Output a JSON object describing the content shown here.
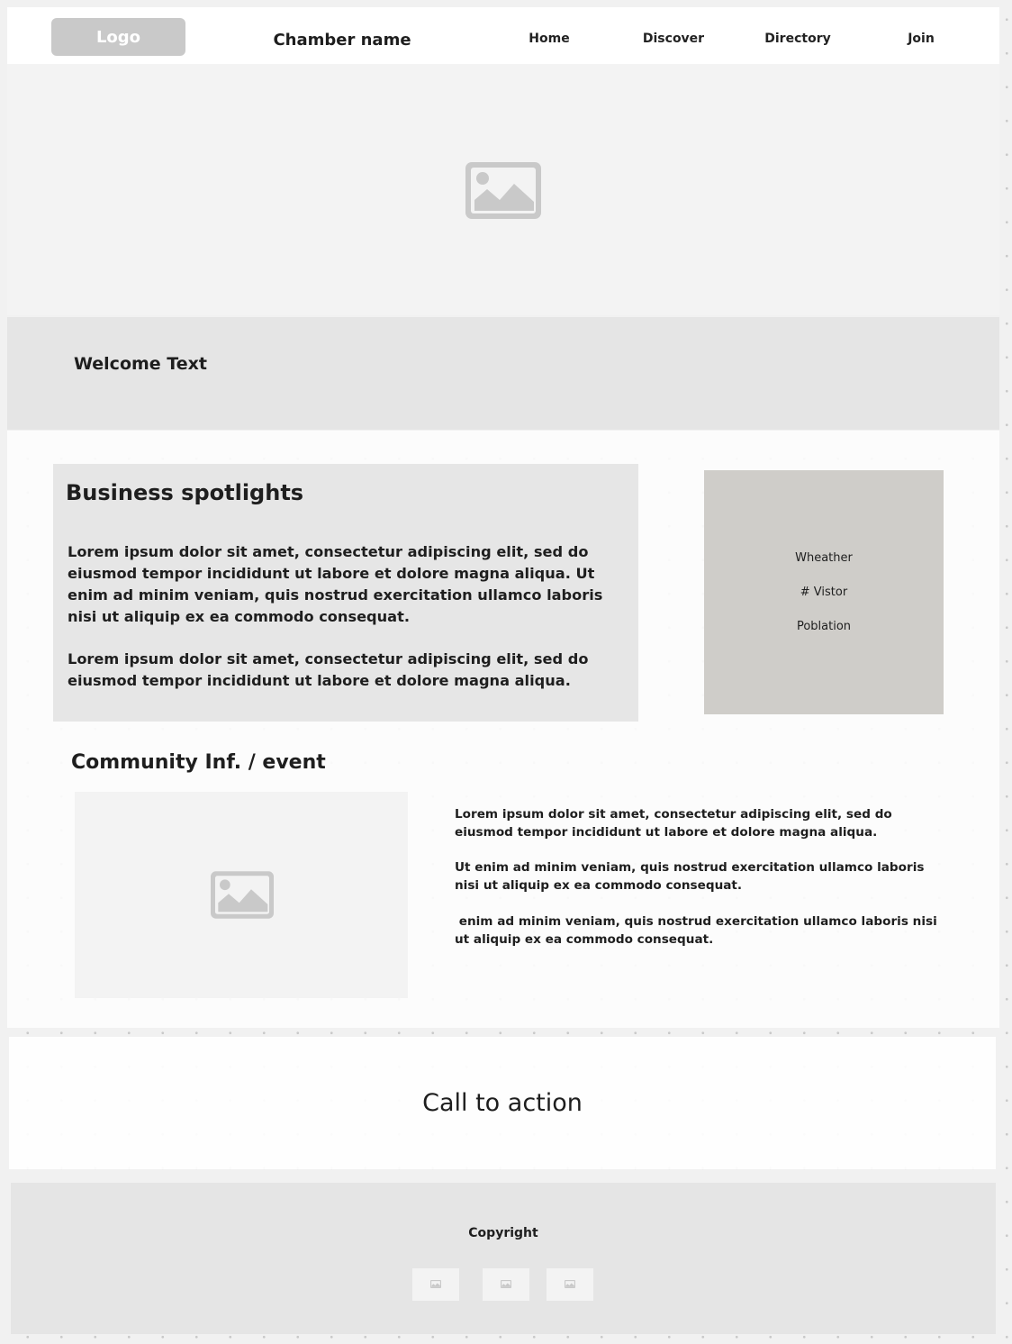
{
  "header": {
    "logo_label": "Logo",
    "chamber_name": "Chamber name",
    "nav": [
      {
        "label": "Home"
      },
      {
        "label": "Discover"
      },
      {
        "label": "Directory"
      },
      {
        "label": "Join"
      }
    ]
  },
  "hero": {
    "image_icon": "image-placeholder-icon"
  },
  "welcome": {
    "text": "Welcome Text"
  },
  "business_spotlights": {
    "title": "Business spotlights",
    "paragraphs": [
      "Lorem ipsum dolor sit amet, consectetur adipiscing elit, sed do eiusmod tempor incididunt ut labore et dolore magna aliqua. Ut enim ad minim veniam, quis nostrud exercitation ullamco laboris nisi ut aliquip ex ea commodo consequat.",
      "Lorem ipsum dolor sit amet, consectetur adipiscing elit, sed do eiusmod tempor incididunt ut labore et dolore magna aliqua."
    ]
  },
  "info_panel": {
    "items": [
      "Wheather",
      "# Vistor",
      "Poblation"
    ]
  },
  "community": {
    "title": "Community Inf. / event",
    "image_icon": "image-placeholder-icon",
    "paragraphs": [
      "Lorem ipsum dolor sit amet, consectetur adipiscing elit, sed do eiusmod tempor incididunt ut labore et dolore magna aliqua.",
      "Ut enim ad minim veniam, quis nostrud exercitation ullamco laboris nisi ut aliquip ex ea commodo consequat.",
      " enim ad minim veniam, quis nostrud exercitation ullamco laboris nisi ut aliquip ex ea commodo consequat."
    ]
  },
  "cta": {
    "text": "Call to action"
  },
  "footer": {
    "copyright": "Copyright",
    "social_icons": [
      "image-icon",
      "image-icon",
      "image-icon"
    ]
  },
  "colors": {
    "placeholder_gray": "#c9c9c9",
    "panel_gray": "#e5e5e5",
    "info_panel": "#cfcdc9",
    "text": "#1e1e1e"
  }
}
